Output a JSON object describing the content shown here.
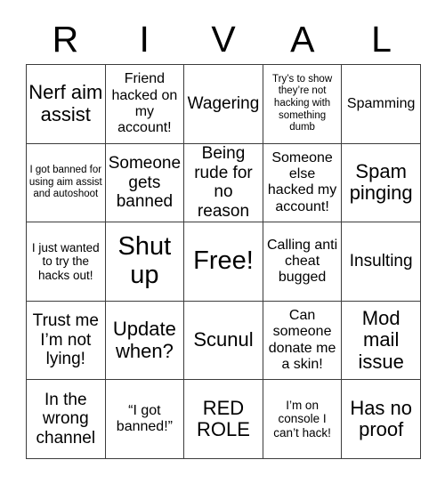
{
  "header": {
    "letters": [
      "R",
      "I",
      "V",
      "A",
      "L"
    ]
  },
  "grid": {
    "columns": 5,
    "rows": 5,
    "cells": [
      [
        {
          "text": "Nerf aim assist",
          "size": "xl"
        },
        {
          "text": "Friend hacked on my account!",
          "size": "md"
        },
        {
          "text": "Wagering",
          "size": "lg"
        },
        {
          "text": "Try’s to show they’re not hacking with something dumb",
          "size": "xs"
        },
        {
          "text": "Spamming",
          "size": "md"
        }
      ],
      [
        {
          "text": "I got banned for using aim assist and autoshoot",
          "size": "xs"
        },
        {
          "text": "Someone gets banned",
          "size": "lg"
        },
        {
          "text": "Being rude for no reason",
          "size": "lg"
        },
        {
          "text": "Someone else hacked my account!",
          "size": "md"
        },
        {
          "text": "Spam pinging",
          "size": "xl"
        }
      ],
      [
        {
          "text": "I just wanted to try the hacks out!",
          "size": "sm"
        },
        {
          "text": "Shut up",
          "size": "xxl"
        },
        {
          "text": "Free!",
          "size": "xxl"
        },
        {
          "text": "Calling anti cheat bugged",
          "size": "md"
        },
        {
          "text": "Insulting",
          "size": "lg"
        }
      ],
      [
        {
          "text": "Trust me I’m not lying!",
          "size": "lg"
        },
        {
          "text": "Update when?",
          "size": "xl"
        },
        {
          "text": "Scunul",
          "size": "xl"
        },
        {
          "text": "Can someone donate me a skin!",
          "size": "md"
        },
        {
          "text": "Mod mail issue",
          "size": "xl"
        }
      ],
      [
        {
          "text": "In the wrong channel",
          "size": "lg"
        },
        {
          "text": "“I got banned!”",
          "size": "md"
        },
        {
          "text": "RED ROLE",
          "size": "xl"
        },
        {
          "text": "I’m on console I can’t hack!",
          "size": "sm"
        },
        {
          "text": "Has no proof",
          "size": "xl"
        }
      ]
    ]
  },
  "style": {
    "border_color": "#3c3c3c",
    "text_color": "#000000",
    "background": "#ffffff"
  }
}
